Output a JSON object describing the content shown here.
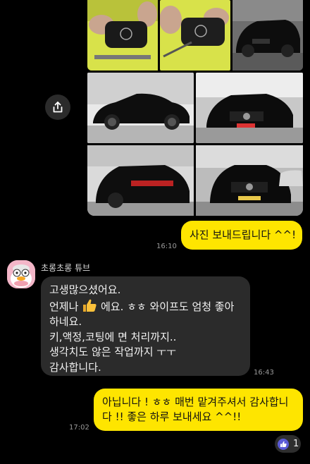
{
  "messages": {
    "m1": {
      "text": "사진 보내드립니다 ^^!",
      "time": "16:10"
    },
    "m2": {
      "sender": "초롱초롱 튜브",
      "line1": "고생많으셨어요.",
      "line2a": "언제나",
      "line2b": "에요. ㅎㅎ 와이프도 엄청 좋아",
      "line3": "하네요.",
      "line4": "키,액정,코팅에 면 처리까지..",
      "line5": "생각치도 않은 작업까지 ㅜㅜ",
      "line6": "감사합니다.",
      "time": "16:43"
    },
    "m3": {
      "line1": "아닙니다 ! ㅎㅎ 매번 맡겨주셔서 감사합니",
      "line2": "다 !! 좋은 하루 보내세요 ^^!!",
      "time": "17:02",
      "reaction_count": "1"
    }
  },
  "photos": [
    "key-photo",
    "key-photo",
    "car-front-photo",
    "car-side-photo",
    "car-front-photo",
    "car-rear-photo",
    "car-front-photo"
  ],
  "colors": {
    "my_bubble": "#fee500",
    "their_bubble": "#2b2b2b",
    "background": "#000000"
  }
}
